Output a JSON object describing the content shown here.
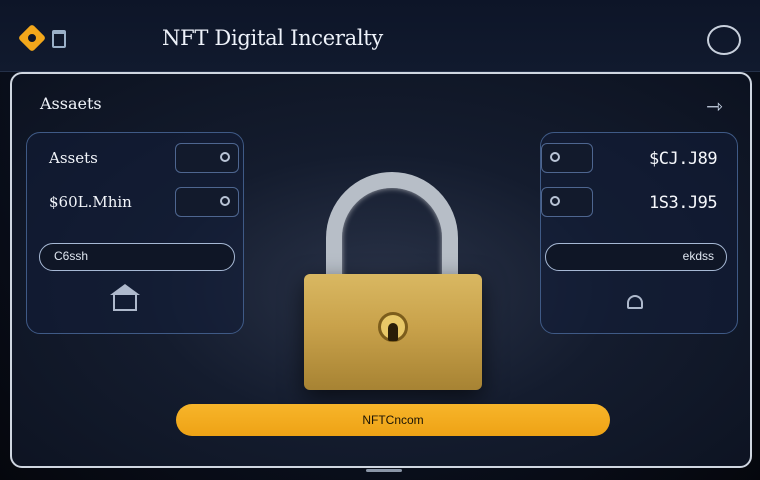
{
  "header": {
    "title": "NFT Digital Inceralty"
  },
  "panel": {
    "title": "Assaets"
  },
  "left_card": {
    "row1_label": "Assets",
    "row2_label": "$60L.Mhin",
    "pill_label": "C6ssh"
  },
  "right_card": {
    "row1_value": "$CJ.J89",
    "row2_value": "1S3.J95",
    "pill_label": "ekdss"
  },
  "cta": {
    "label": "NFTCncom"
  },
  "colors": {
    "accent": "#f2a71b",
    "lock_gold": "#c9a24b",
    "panel_border": "#cfd6e0"
  }
}
